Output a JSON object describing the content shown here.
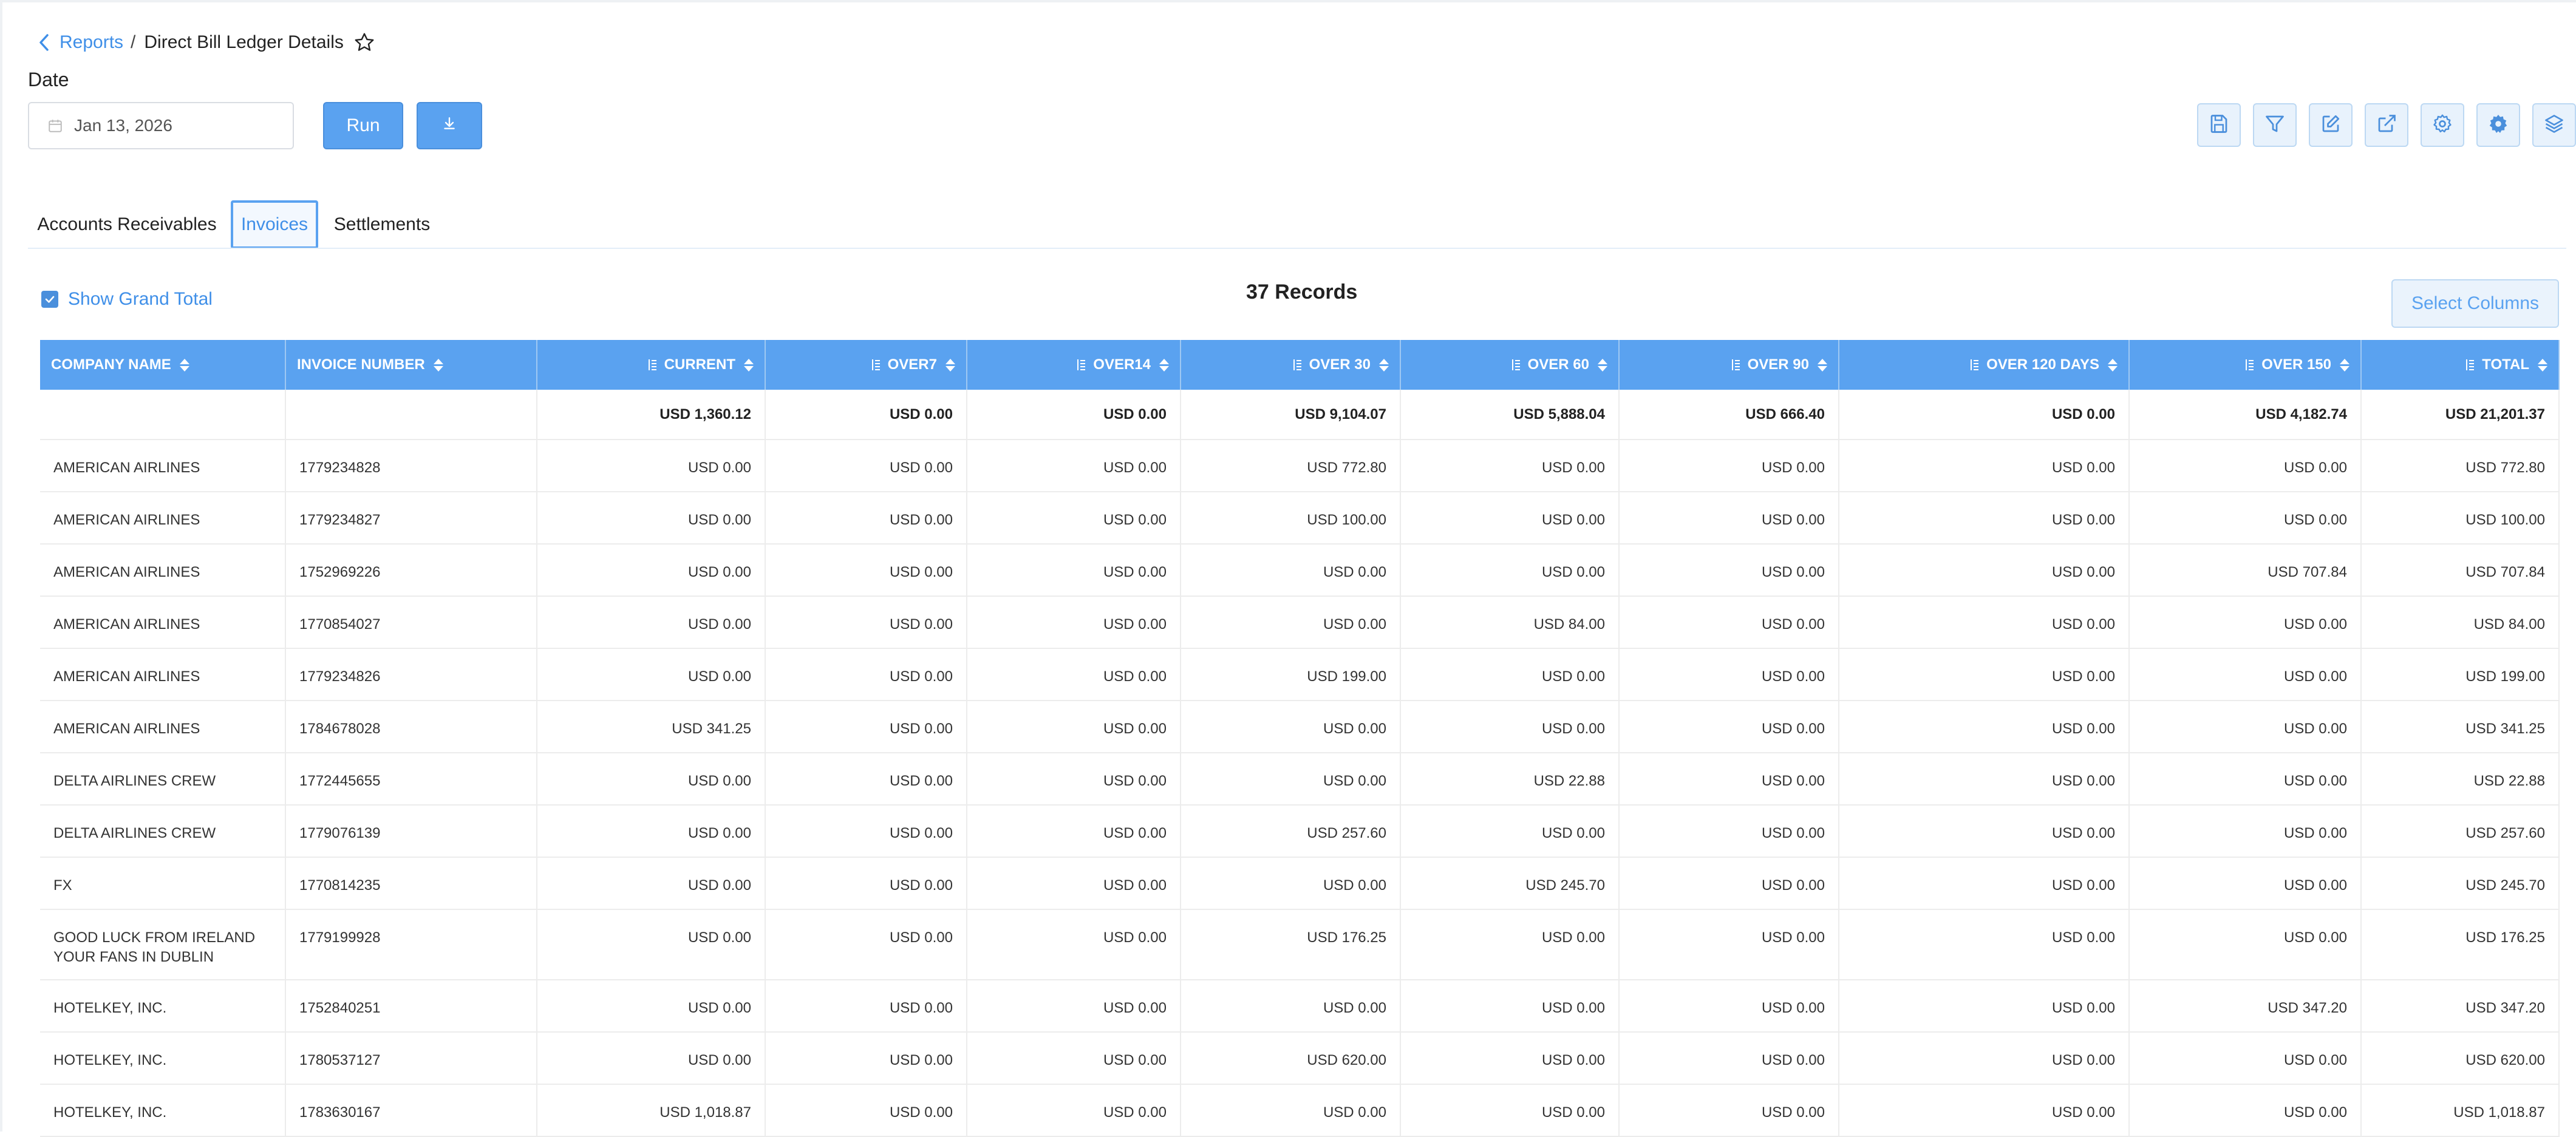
{
  "breadcrumb": {
    "parent": "Reports",
    "separator": "/",
    "current": "Direct Bill Ledger Details"
  },
  "date_filter": {
    "label": "Date",
    "value": "Jan 13, 2026"
  },
  "actions": {
    "run_label": "Run"
  },
  "toolbar": [
    "save-icon",
    "filter-icon",
    "edit-icon",
    "external-link-icon",
    "settings-icon",
    "gear-badge-icon",
    "layers-icon"
  ],
  "tabs": [
    {
      "label": "Accounts Receivables",
      "active": false
    },
    {
      "label": "Invoices",
      "active": true
    },
    {
      "label": "Settlements",
      "active": false
    }
  ],
  "show_grand_total": {
    "label": "Show Grand Total",
    "checked": true
  },
  "records_label": "37 Records",
  "select_columns_label": "Select Columns",
  "table": {
    "columns": [
      "COMPANY NAME",
      "INVOICE NUMBER",
      "CURRENT",
      "OVER7",
      "OVER14",
      "OVER 30",
      "OVER 60",
      "OVER 90",
      "OVER 120 DAYS",
      "OVER 150",
      "TOTAL"
    ],
    "totals": [
      "",
      "",
      "USD 1,360.12",
      "USD 0.00",
      "USD 0.00",
      "USD 9,104.07",
      "USD 5,888.04",
      "USD 666.40",
      "USD 0.00",
      "USD 4,182.74",
      "USD 21,201.37"
    ],
    "rows": [
      [
        "AMERICAN AIRLINES",
        "1779234828",
        "USD 0.00",
        "USD 0.00",
        "USD 0.00",
        "USD 772.80",
        "USD 0.00",
        "USD 0.00",
        "USD 0.00",
        "USD 0.00",
        "USD 772.80"
      ],
      [
        "AMERICAN AIRLINES",
        "1779234827",
        "USD 0.00",
        "USD 0.00",
        "USD 0.00",
        "USD 100.00",
        "USD 0.00",
        "USD 0.00",
        "USD 0.00",
        "USD 0.00",
        "USD 100.00"
      ],
      [
        "AMERICAN AIRLINES",
        "1752969226",
        "USD 0.00",
        "USD 0.00",
        "USD 0.00",
        "USD 0.00",
        "USD 0.00",
        "USD 0.00",
        "USD 0.00",
        "USD 707.84",
        "USD 707.84"
      ],
      [
        "AMERICAN AIRLINES",
        "1770854027",
        "USD 0.00",
        "USD 0.00",
        "USD 0.00",
        "USD 0.00",
        "USD 84.00",
        "USD 0.00",
        "USD 0.00",
        "USD 0.00",
        "USD 84.00"
      ],
      [
        "AMERICAN AIRLINES",
        "1779234826",
        "USD 0.00",
        "USD 0.00",
        "USD 0.00",
        "USD 199.00",
        "USD 0.00",
        "USD 0.00",
        "USD 0.00",
        "USD 0.00",
        "USD 199.00"
      ],
      [
        "AMERICAN AIRLINES",
        "1784678028",
        "USD 341.25",
        "USD 0.00",
        "USD 0.00",
        "USD 0.00",
        "USD 0.00",
        "USD 0.00",
        "USD 0.00",
        "USD 0.00",
        "USD 341.25"
      ],
      [
        "DELTA AIRLINES CREW",
        "1772445655",
        "USD 0.00",
        "USD 0.00",
        "USD 0.00",
        "USD 0.00",
        "USD 22.88",
        "USD 0.00",
        "USD 0.00",
        "USD 0.00",
        "USD 22.88"
      ],
      [
        "DELTA AIRLINES CREW",
        "1779076139",
        "USD 0.00",
        "USD 0.00",
        "USD 0.00",
        "USD 257.60",
        "USD 0.00",
        "USD 0.00",
        "USD 0.00",
        "USD 0.00",
        "USD 257.60"
      ],
      [
        "FX",
        "1770814235",
        "USD 0.00",
        "USD 0.00",
        "USD 0.00",
        "USD 0.00",
        "USD 245.70",
        "USD 0.00",
        "USD 0.00",
        "USD 0.00",
        "USD 245.70"
      ],
      [
        "GOOD LUCK FROM IRELAND YOUR FANS IN DUBLIN",
        "1779199928",
        "USD 0.00",
        "USD 0.00",
        "USD 0.00",
        "USD 176.25",
        "USD 0.00",
        "USD 0.00",
        "USD 0.00",
        "USD 0.00",
        "USD 176.25"
      ],
      [
        "HOTELKEY, INC.",
        "1752840251",
        "USD 0.00",
        "USD 0.00",
        "USD 0.00",
        "USD 0.00",
        "USD 0.00",
        "USD 0.00",
        "USD 0.00",
        "USD 347.20",
        "USD 347.20"
      ],
      [
        "HOTELKEY, INC.",
        "1780537127",
        "USD 0.00",
        "USD 0.00",
        "USD 0.00",
        "USD 620.00",
        "USD 0.00",
        "USD 0.00",
        "USD 0.00",
        "USD 0.00",
        "USD 620.00"
      ],
      [
        "HOTELKEY, INC.",
        "1783630167",
        "USD 1,018.87",
        "USD 0.00",
        "USD 0.00",
        "USD 0.00",
        "USD 0.00",
        "USD 0.00",
        "USD 0.00",
        "USD 0.00",
        "USD 1,018.87"
      ]
    ]
  },
  "colors": {
    "accent": "#5aa2f0",
    "link": "#3f8fe8",
    "toolbar_bg": "#e8f2fc"
  }
}
